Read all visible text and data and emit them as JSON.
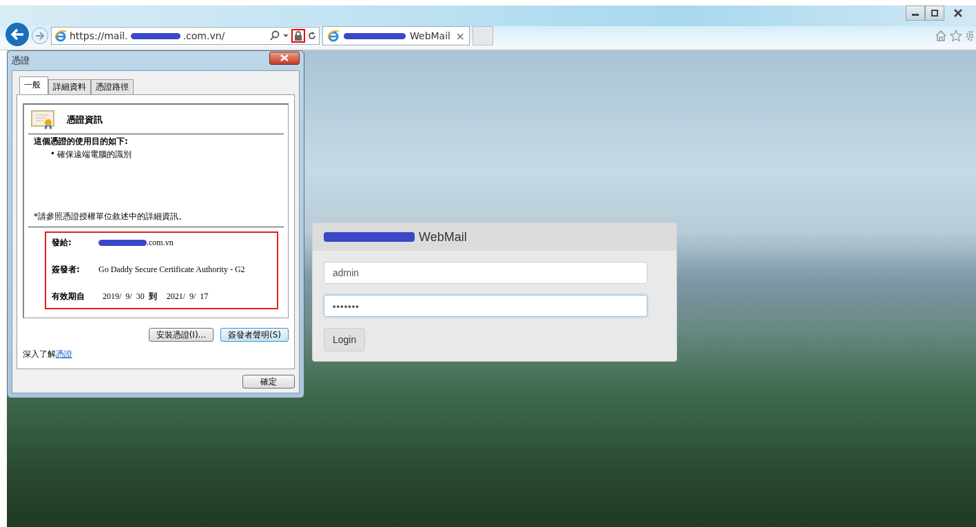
{
  "browser": {
    "address": {
      "prefix": "https://mail.",
      "suffix": ".com.vn/"
    },
    "tabs": [
      {
        "title": "WebMail",
        "close": "×",
        "selected": true
      }
    ]
  },
  "dialog": {
    "title": "憑證",
    "tabs": [
      {
        "label": "一般",
        "selected": true
      },
      {
        "label": "詳細資料",
        "selected": false
      },
      {
        "label": "憑證路徑",
        "selected": false
      }
    ],
    "header": "憑證資訊",
    "purpose_heading": "這個憑證的使用目的如下:",
    "purposes": [
      {
        "bullet": "•",
        "text": "確保遠端電腦的識別"
      }
    ],
    "note": "*請參照憑證授權單位敘述中的詳細資訊。",
    "issued_to": {
      "label": "發給:",
      "value_suffix": ".com.vn"
    },
    "issued_by": {
      "label": "簽發者:",
      "value": "Go Daddy Secure Certificate Authority - G2"
    },
    "validity": {
      "label": "有效期自",
      "from": "2019/  9/  30",
      "to_word": "到",
      "to": "2021/  9/  17"
    },
    "buttons": [
      {
        "label": "安裝憑證(I)...",
        "focused": false
      },
      {
        "label": "簽發者聲明(S)",
        "focused": true
      }
    ],
    "learn_more": {
      "text": "深入了解",
      "link": "憑證"
    },
    "ok": "確定"
  },
  "login": {
    "title_suffix": "WebMail",
    "username": "admin",
    "password": "•••••••",
    "button": "Login"
  }
}
